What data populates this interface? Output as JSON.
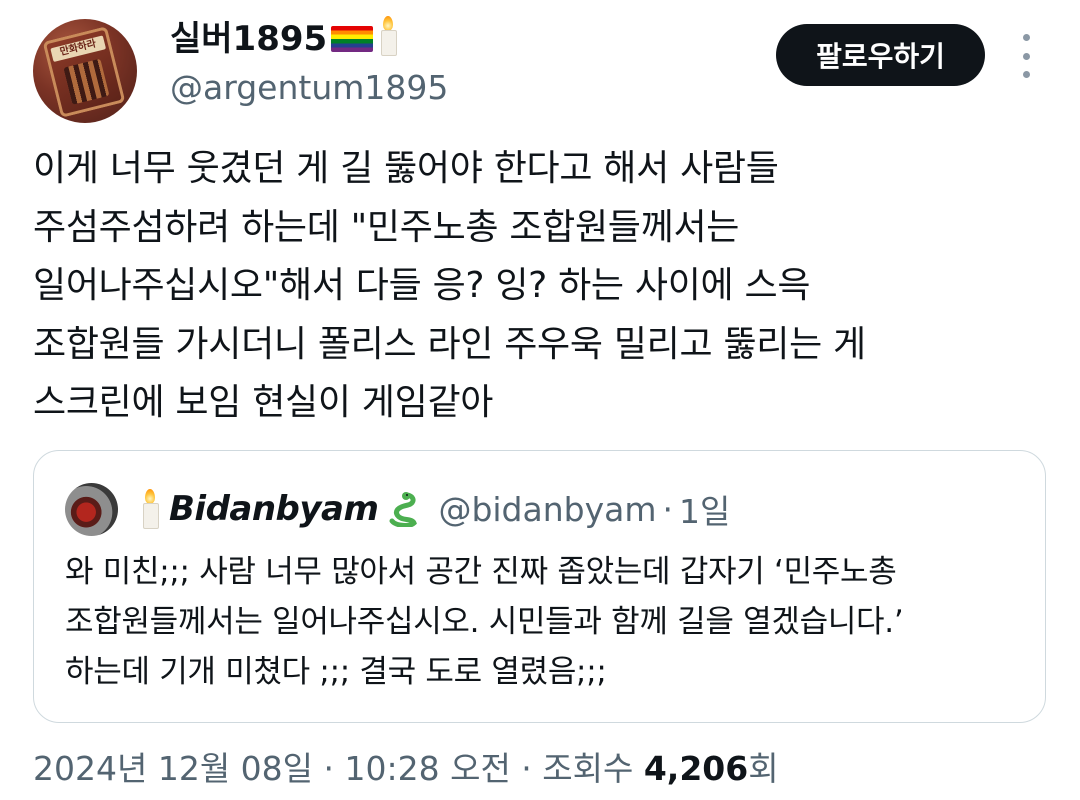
{
  "author": {
    "name": "실버1895",
    "handle": "@argentum1895",
    "avatar_label": "만화하라",
    "flag_icon": "rainbow-flag-icon",
    "candle_icon": "candle-icon"
  },
  "follow_button": {
    "label": "팔로우하기"
  },
  "tweet": {
    "text": "이게 너무 웃겼던 게 길 뚫어야 한다고 해서 사람들\n주섬주섬하려 하는데 \"민주노총 조합원들께서는\n일어나주십시오\"해서 다들 응? 잉? 하는 사이에 스윽\n조합원들 가시더니 폴리스 라인 주우욱 밀리고 뚫리는 게\n스크린에 보임 현실이 게임같아"
  },
  "quote": {
    "name": "Bidanbyam",
    "handle": "@bidanbyam",
    "separator": "·",
    "time": "1일",
    "text": "와 미친;;; 사람 너무 많아서 공간 진짜 좁았는데 갑자기 ‘민주노총\n조합원들께서는 일어나주십시오. 시민들과 함께 길을 열겠습니다.’\n하는데 기개 미쳤다 ;;; 결국 도로 열렸음;;;",
    "snake_icon": "snake-icon"
  },
  "meta": {
    "timestamp": "2024년 12월 08일 · 10:28 오전 · 조회수 ",
    "views": "4,206",
    "views_suffix": "회"
  }
}
